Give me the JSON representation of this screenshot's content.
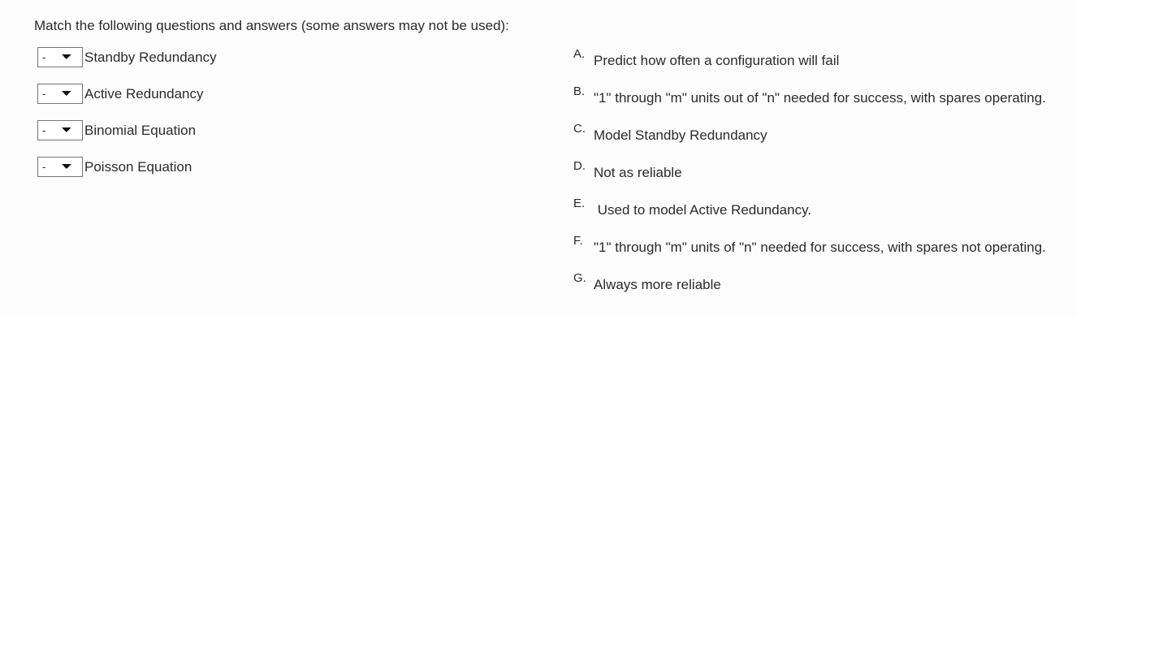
{
  "exercise": {
    "prompt": "Match the following questions and answers (some answers may not be used):",
    "select_placeholder": "-",
    "select_options": [
      "-",
      "A.",
      "B.",
      "C.",
      "D.",
      "E.",
      "F.",
      "G."
    ],
    "questions": [
      {
        "label": "Standby Redundancy",
        "selected": "-"
      },
      {
        "label": "Active Redundancy",
        "selected": "-"
      },
      {
        "label": "Binomial Equation",
        "selected": "-"
      },
      {
        "label": "Poisson Equation",
        "selected": "-"
      }
    ],
    "options": [
      {
        "letter": "A.",
        "text": "Predict how often a configuration will fail"
      },
      {
        "letter": "B.",
        "text": "\"1\" through \"m\" units out of \"n\" needed for success, with spares operating."
      },
      {
        "letter": "C.",
        "text": "Model Standby Redundancy"
      },
      {
        "letter": "D.",
        "text": "Not as reliable"
      },
      {
        "letter": "E.",
        "text": " Used to model Active Redundancy."
      },
      {
        "letter": "F.",
        "text": "\"1\" through \"m\" units of \"n\" needed for success, with spares not operating."
      },
      {
        "letter": "G.",
        "text": "Always more reliable"
      }
    ]
  },
  "colors": {
    "text": "#2b2b2b",
    "select_border": "#767676",
    "page_background": "#ffffff",
    "panel_background": "#fdfdfd"
  }
}
